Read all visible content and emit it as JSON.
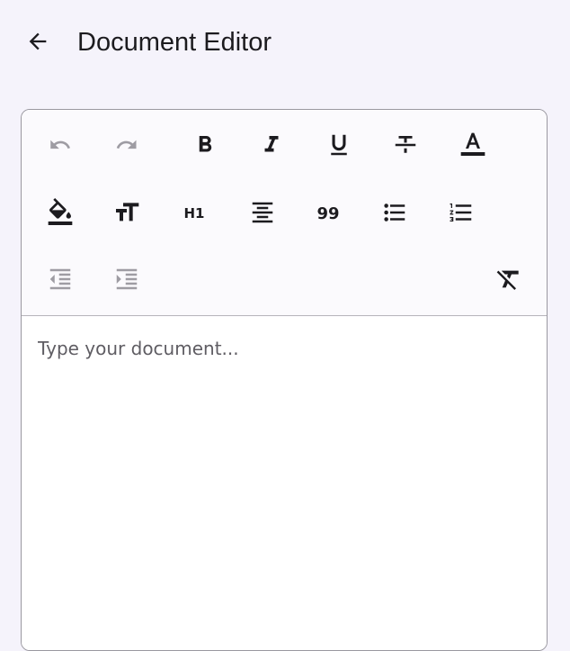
{
  "app_bar": {
    "title": "Document Editor",
    "back_icon": "arrow-left-icon"
  },
  "toolbar": {
    "buttons": [
      {
        "id": "undo",
        "icon": "undo-icon",
        "enabled": false
      },
      {
        "id": "redo",
        "icon": "redo-icon",
        "enabled": false
      },
      {
        "id": "bold",
        "icon": "bold-icon",
        "enabled": true
      },
      {
        "id": "italic",
        "icon": "italic-icon",
        "enabled": true
      },
      {
        "id": "underline",
        "icon": "underline-icon",
        "enabled": true
      },
      {
        "id": "strikethrough",
        "icon": "strikethrough-icon",
        "enabled": true
      },
      {
        "id": "text-color",
        "icon": "text-color-icon",
        "enabled": true
      },
      {
        "id": "background-color",
        "icon": "fill-color-icon",
        "enabled": true
      },
      {
        "id": "font-size",
        "icon": "text-size-icon",
        "enabled": true
      },
      {
        "id": "heading",
        "icon": "heading-h1-icon",
        "enabled": true
      },
      {
        "id": "align",
        "icon": "align-center-icon",
        "enabled": true
      },
      {
        "id": "quote",
        "icon": "quote-icon",
        "enabled": true
      },
      {
        "id": "bullet-list",
        "icon": "bullet-list-icon",
        "enabled": true
      },
      {
        "id": "numbered-list",
        "icon": "numbered-list-icon",
        "enabled": true
      },
      {
        "id": "indent-decrease",
        "icon": "indent-decrease-icon",
        "enabled": false
      },
      {
        "id": "indent-increase",
        "icon": "indent-increase-icon",
        "enabled": false
      },
      {
        "id": "clear-format",
        "icon": "clear-format-icon",
        "enabled": true
      }
    ],
    "labels": {
      "heading": "H1",
      "quote": "99"
    }
  },
  "editor": {
    "value": "",
    "placeholder": "Type your document..."
  },
  "colors": {
    "background": "#f5f3fb",
    "icon_active": "#1c1b1f",
    "icon_disabled": "#9e9ca3",
    "border": "#9a98a0"
  }
}
